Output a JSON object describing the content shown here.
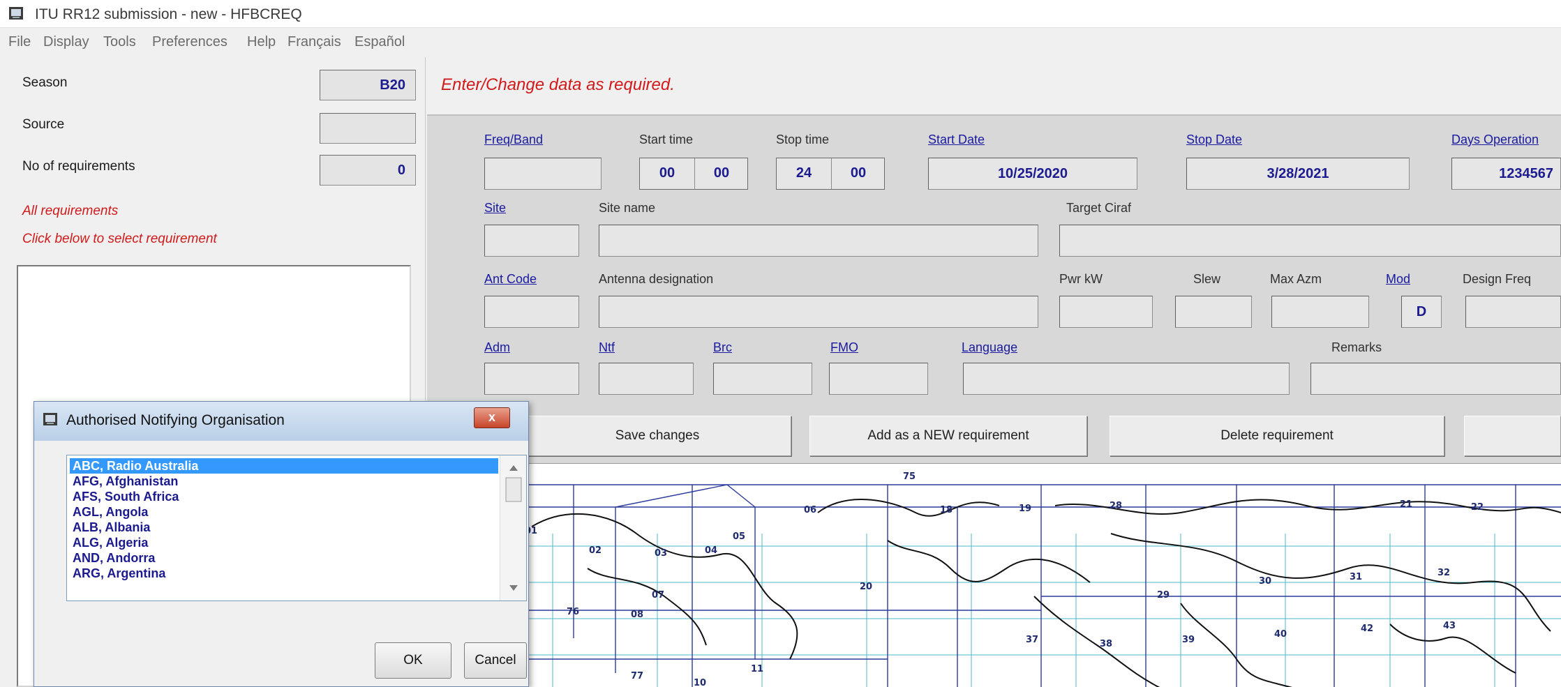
{
  "window": {
    "title": "ITU RR12 submission - new - HFBCREQ"
  },
  "menu": [
    "File",
    "Display",
    "Tools",
    "Preferences",
    "Help",
    "Français",
    "Español"
  ],
  "left": {
    "season_label": "Season",
    "season_value": "B20",
    "source_label": "Source",
    "source_value": "",
    "no_req_label": "No of requirements",
    "no_req_value": "0",
    "all_req": "All requirements",
    "click_below": "Click below to select requirement"
  },
  "message": "Enter/Change data as required.",
  "form": {
    "freq_band": "Freq/Band",
    "start_time": "Start time",
    "stop_time": "Stop time",
    "start_date": "Start Date",
    "stop_date": "Stop Date",
    "days_operation": "Days Operation",
    "start_hh": "00",
    "start_mm": "00",
    "stop_hh": "24",
    "stop_mm": "00",
    "start_date_val": "10/25/2020",
    "stop_date_val": "3/28/2021",
    "days_val": "1234567",
    "site": "Site",
    "site_name": "Site name",
    "target_ciraf": "Target Ciraf",
    "ant_code": "Ant Code",
    "antenna_designation": "Antenna designation",
    "pwr_kw": "Pwr kW",
    "slew": "Slew",
    "max_azm": "Max Azm",
    "mod": "Mod",
    "mod_val": "D",
    "design_freq": "Design Freq",
    "adm": "Adm",
    "ntf": "Ntf",
    "brc": "Brc",
    "fmo": "FMO",
    "language": "Language",
    "remarks": "Remarks"
  },
  "buttons": {
    "save": "Save changes",
    "add_new": "Add as a NEW requirement",
    "delete": "Delete requirement"
  },
  "map": {
    "labels": [
      "75",
      "01",
      "02",
      "03",
      "04",
      "05",
      "06",
      "07",
      "08",
      "11",
      "18",
      "19",
      "20",
      "21",
      "22",
      "28",
      "29",
      "30",
      "31",
      "32",
      "37",
      "38",
      "39",
      "40",
      "42",
      "43",
      "76",
      "77",
      "10"
    ]
  },
  "dialog": {
    "title": "Authorised Notifying Organisation",
    "close": "x",
    "items": [
      "ABC, Radio Australia",
      "AFG, Afghanistan",
      "AFS, South Africa",
      "AGL, Angola",
      "ALB, Albania",
      "ALG, Algeria",
      "AND, Andorra",
      "ARG, Argentina"
    ],
    "ok": "OK",
    "cancel": "Cancel"
  },
  "colors": {
    "accent_red": "#d11a1a",
    "value_blue": "#1b1b8f",
    "selection": "#3399ff"
  }
}
